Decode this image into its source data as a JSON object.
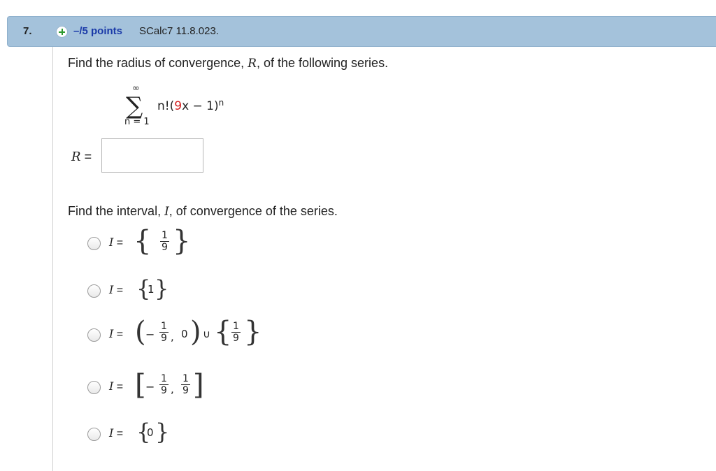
{
  "question": {
    "number": "7.",
    "points": "–/5 points",
    "source": "SCalc7 11.8.023."
  },
  "part1": {
    "prompt_pre": "Find the radius of convergence, ",
    "prompt_var": "R",
    "prompt_post": ", of the following series.",
    "sum_upper": "∞",
    "sum_lower": "n = 1",
    "term_a": "n!(",
    "term_red": "9",
    "term_b": "x − 1)",
    "term_exp": "n",
    "answer_label_var": "R",
    "answer_label_eq": " =",
    "answer_value": ""
  },
  "part2": {
    "prompt_pre": "Find the interval, ",
    "prompt_var": "I",
    "prompt_post": ", of convergence of the series.",
    "option_label_var": "I",
    "option_label_eq": " =",
    "options": [
      {
        "text": "{1/9}"
      },
      {
        "text": "{1}"
      },
      {
        "text": "(−1/9, 0) ∪ {1/9}"
      },
      {
        "text": "[−1/9, 1/9]"
      },
      {
        "text": "{0}"
      }
    ],
    "frac_num": "1",
    "frac_den": "9",
    "one": "1",
    "zero": "0",
    "minus": "−",
    "comma": ",",
    "union": "∪"
  }
}
